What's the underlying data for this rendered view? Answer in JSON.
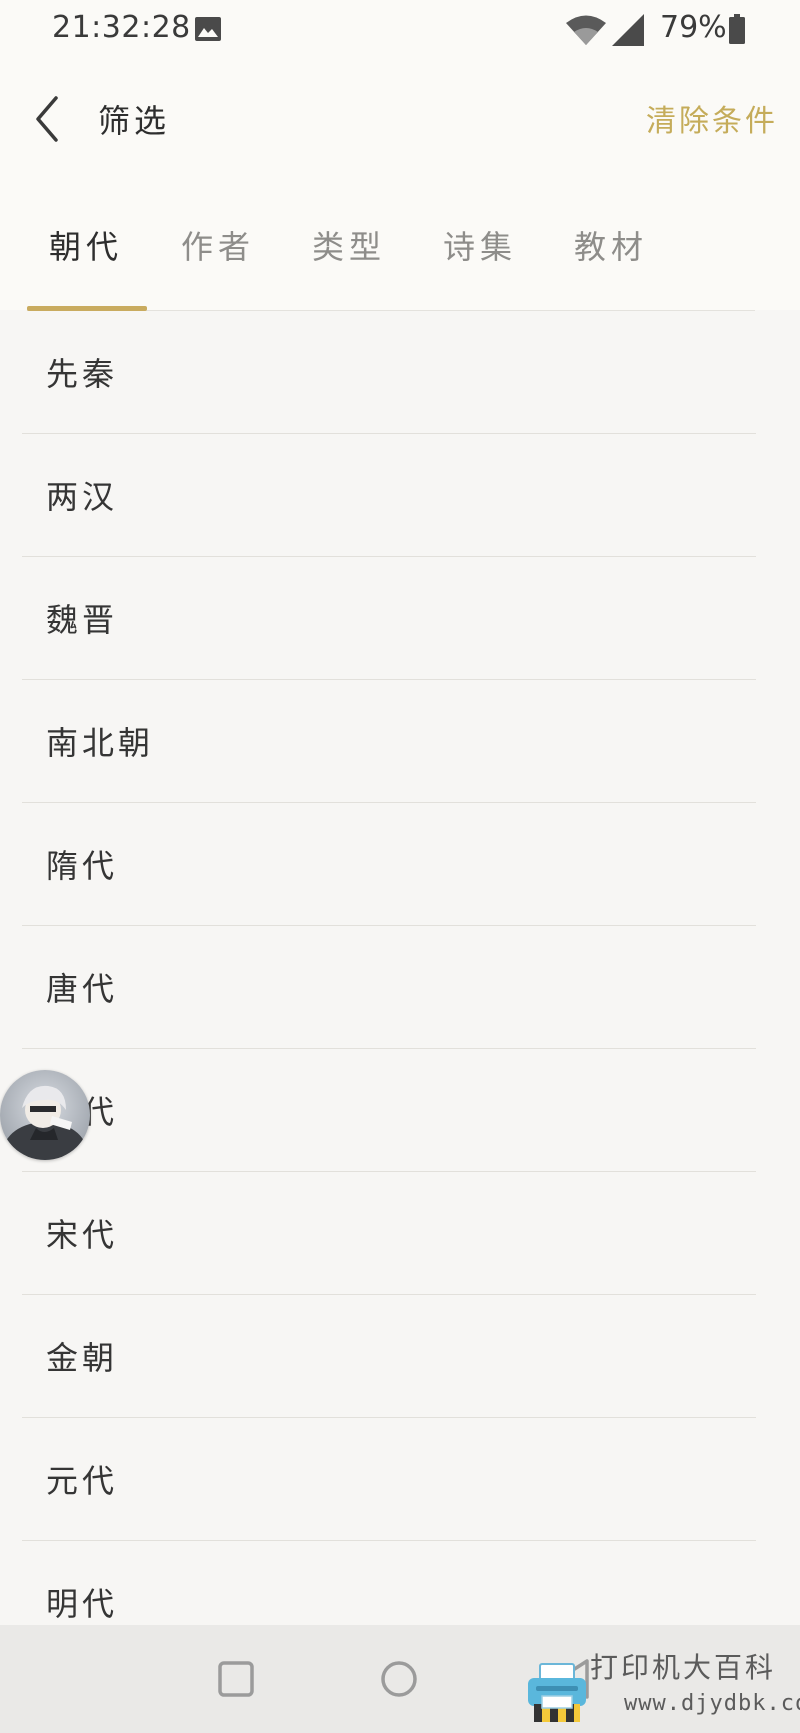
{
  "status_bar": {
    "time": "21:32:28",
    "battery_percent": "79%",
    "icons": [
      "photo-icon",
      "wifi-icon",
      "cellular-signal-icon",
      "battery-icon"
    ]
  },
  "header": {
    "title": "筛选",
    "clear_label": "清除条件",
    "back_icon": "chevron-left-icon"
  },
  "tabs": [
    {
      "label": "朝代",
      "active": true
    },
    {
      "label": "作者",
      "active": false
    },
    {
      "label": "类型",
      "active": false
    },
    {
      "label": "诗集",
      "active": false
    },
    {
      "label": "教材",
      "active": false
    }
  ],
  "dynasties": [
    {
      "label": "先秦"
    },
    {
      "label": "两汉"
    },
    {
      "label": "魏晋"
    },
    {
      "label": "南北朝"
    },
    {
      "label": "隋代"
    },
    {
      "label": "唐代"
    },
    {
      "label": "代"
    },
    {
      "label": "宋代"
    },
    {
      "label": "金朝"
    },
    {
      "label": "元代"
    },
    {
      "label": "明代"
    }
  ],
  "nav_bar": {
    "icons": [
      "recent-apps-icon",
      "home-icon",
      "back-triangle-icon"
    ]
  },
  "watermark": {
    "text": "打印机大百科",
    "url": "www.djydbk.com"
  },
  "colors": {
    "accent": "#c9ab5f",
    "clear_text": "#c5ac5a",
    "background": "#f7f6f4",
    "top_background": "#fbfaf7",
    "nav_background": "#eae9e7"
  }
}
